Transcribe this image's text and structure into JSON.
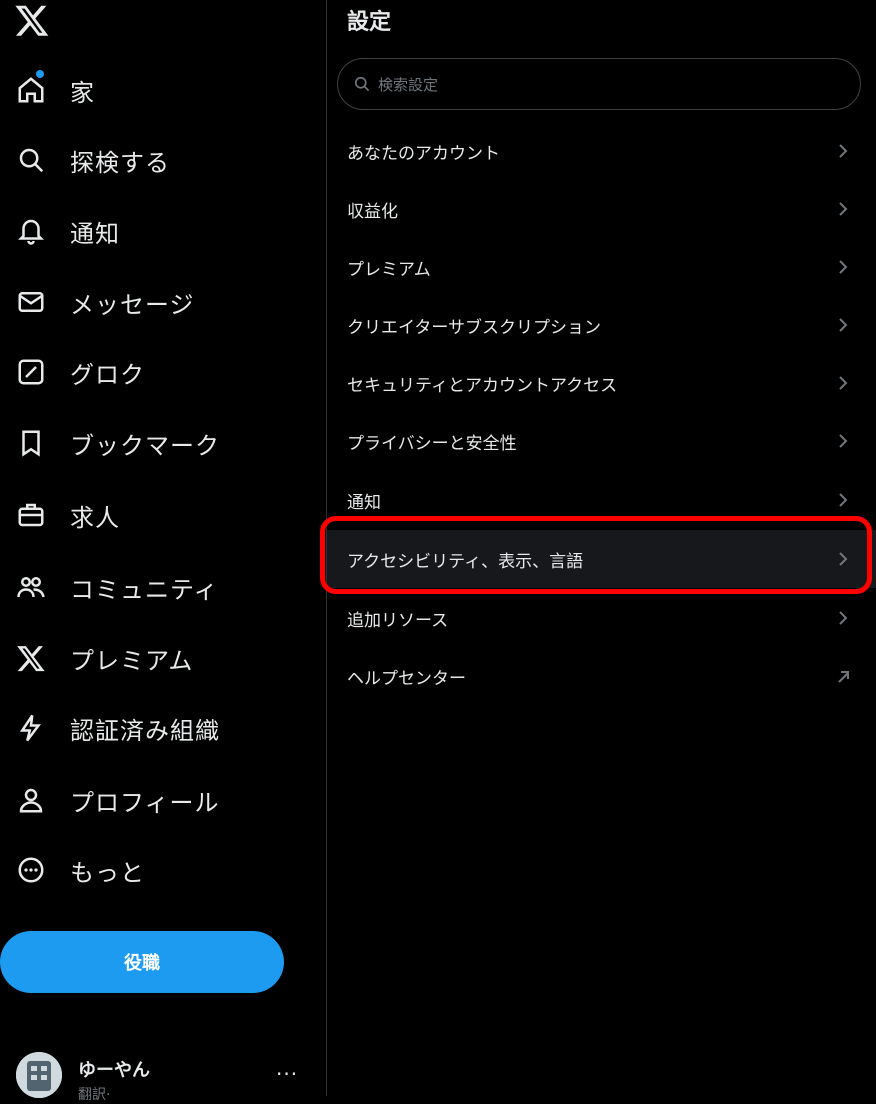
{
  "sidebar": {
    "logo_icon": "x-logo-icon",
    "items": [
      {
        "label": "家",
        "icon": "home-icon",
        "has_dot": true
      },
      {
        "label": "探検する",
        "icon": "search-icon"
      },
      {
        "label": "通知",
        "icon": "bell-icon"
      },
      {
        "label": "メッセージ",
        "icon": "envelope-icon"
      },
      {
        "label": "グロク",
        "icon": "grok-icon"
      },
      {
        "label": "ブックマーク",
        "icon": "bookmark-icon"
      },
      {
        "label": "求人",
        "icon": "briefcase-icon"
      },
      {
        "label": "コミュニティ",
        "icon": "people-icon"
      },
      {
        "label": "プレミアム",
        "icon": "x-logo-icon"
      },
      {
        "label": "認証済み組織",
        "icon": "lightning-icon"
      },
      {
        "label": "プロフィール",
        "icon": "person-icon"
      },
      {
        "label": "もっと",
        "icon": "more-circle-icon"
      }
    ],
    "post_button": "役職",
    "account": {
      "name": "ゆーやん",
      "handle": "翻訳·",
      "more": "···"
    }
  },
  "settings": {
    "title": "設定",
    "search_placeholder": "検索設定",
    "items": [
      {
        "label": "あなたのアカウント",
        "icon": "chevron-right-icon"
      },
      {
        "label": "収益化",
        "icon": "chevron-right-icon"
      },
      {
        "label": "プレミアム",
        "icon": "chevron-right-icon"
      },
      {
        "label": "クリエイターサブスクリプション",
        "icon": "chevron-right-icon"
      },
      {
        "label": "セキュリティとアカウントアクセス",
        "icon": "chevron-right-icon"
      },
      {
        "label": "プライバシーと安全性",
        "icon": "chevron-right-icon"
      },
      {
        "label": "通知",
        "icon": "chevron-right-icon"
      },
      {
        "label": "アクセシビリティ、表示、言語",
        "icon": "chevron-right-icon",
        "highlighted": true
      },
      {
        "label": "追加リソース",
        "icon": "chevron-right-icon"
      },
      {
        "label": "ヘルプセンター",
        "icon": "external-link-icon"
      }
    ]
  },
  "colors": {
    "accent": "#1d9bf0",
    "highlight": "#ff0000",
    "background": "#000000"
  }
}
